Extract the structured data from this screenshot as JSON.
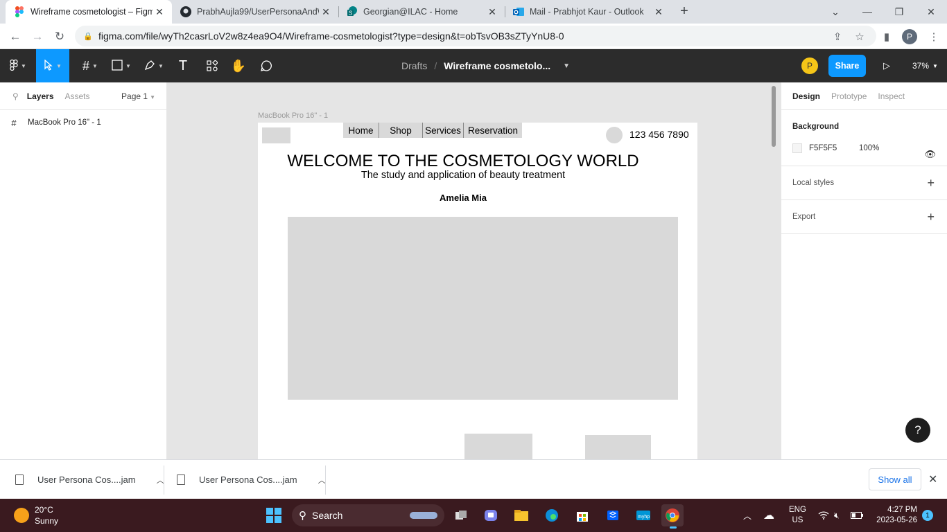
{
  "browser": {
    "tabs": [
      {
        "title": "Wireframe cosmetologist – Figma",
        "icon": "figma-icon",
        "active": true
      },
      {
        "title": "PrabhAujla99/UserPersonaAndW",
        "icon": "github-icon",
        "active": false
      },
      {
        "title": "Georgian@ILAC - Home",
        "icon": "sharepoint-icon",
        "active": false
      },
      {
        "title": "Mail - Prabhjot Kaur - Outlook",
        "icon": "outlook-icon",
        "active": false
      }
    ],
    "url": "figma.com/file/wyTh2casrLoV2w8z4ea9O4/Wireframe-cosmetologist?type=design&t=obTsvOB3sZTyYnU8-0",
    "profile_initial": "P"
  },
  "figma": {
    "breadcrumb": {
      "folder": "Drafts",
      "file": "Wireframe cosmetolo..."
    },
    "user_initial": "P",
    "share_label": "Share",
    "zoom": "37%",
    "left_panel": {
      "tabs": [
        "Layers",
        "Assets"
      ],
      "page": "Page 1",
      "layers": [
        "MacBook Pro 16\" - 1"
      ]
    },
    "canvas": {
      "frame_label": "MacBook Pro 16\" - 1",
      "nav": [
        "Home",
        "Shop",
        "Services",
        "Reservation"
      ],
      "phone": "123 456 7890",
      "heading": "WELCOME TO THE COSMETOLOGY WORLD",
      "subheading": "The study and application of beauty treatment",
      "author": "Amelia Mia"
    },
    "right_panel": {
      "tabs": [
        "Design",
        "Prototype",
        "Inspect"
      ],
      "background_title": "Background",
      "bg_hex": "F5F5F5",
      "bg_opacity": "100%",
      "local_styles": "Local styles",
      "export": "Export"
    },
    "help": "?"
  },
  "downloads": {
    "items": [
      "User Persona Cos....jam",
      "User Persona Cos....jam"
    ],
    "show_all": "Show all"
  },
  "taskbar": {
    "weather_temp": "20°C",
    "weather_desc": "Sunny",
    "search": "Search",
    "lang": "ENG",
    "region": "US",
    "time": "4:27 PM",
    "date": "2023-05-26",
    "notifications": "1"
  },
  "colors": {
    "accent": "#0d99ff",
    "toolbar": "#2c2c2c",
    "placeholder": "#d9d9d9"
  }
}
